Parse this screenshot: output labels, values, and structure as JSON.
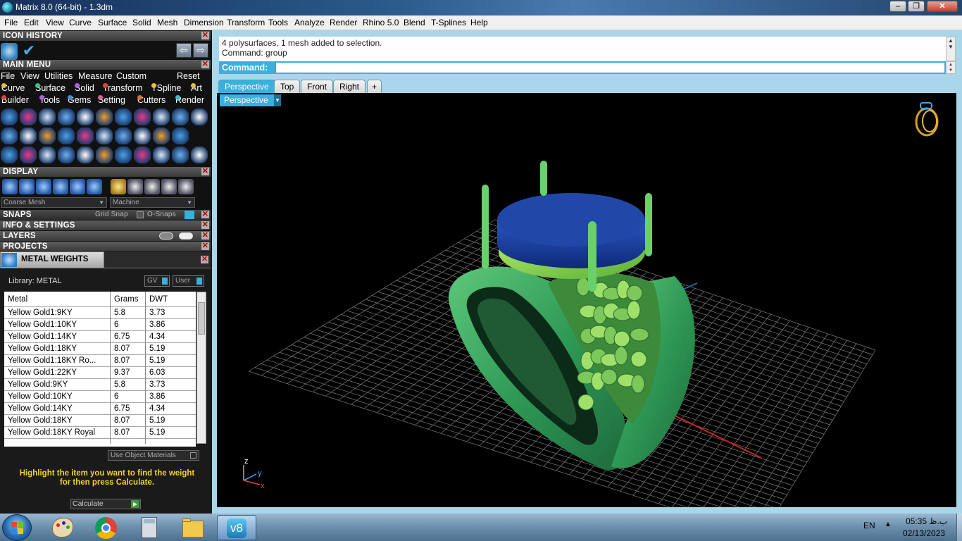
{
  "window": {
    "title": "Matrix 8.0 (64-bit) - 1.3dm",
    "minimize": "‒",
    "maximize": "❐",
    "close": "✕"
  },
  "menubar": {
    "items": [
      "File",
      "Edit",
      "View",
      "Curve",
      "Surface",
      "Solid",
      "Mesh",
      "Dimension",
      "Transform",
      "Tools",
      "Analyze",
      "Render",
      "Rhino 5.0",
      "Blend",
      "T-Splines",
      "Help"
    ]
  },
  "panel": {
    "icon_history": "ICON HISTORY",
    "main_menu": "MAIN MENU",
    "main_menu_items": [
      "File",
      "View",
      "Utilities",
      "Measure",
      "Custom"
    ],
    "reset": "Reset",
    "row1": [
      {
        "label": "Curve",
        "color": "#e0c040"
      },
      {
        "label": "Surface",
        "color": "#40c080"
      },
      {
        "label": "Solid",
        "color": "#b060e0"
      },
      {
        "label": "Transform",
        "color": "#e04040"
      },
      {
        "label": "TSpline",
        "color": "#e0c040"
      },
      {
        "label": "Art",
        "color": "#e0c040"
      }
    ],
    "row2": [
      {
        "label": "Builder",
        "color": "#e04040"
      },
      {
        "label": "Tools",
        "color": "#b060e0"
      },
      {
        "label": "Gems",
        "color": "#4090e0"
      },
      {
        "label": "Setting",
        "color": "#e060a0"
      },
      {
        "label": "Cutters",
        "color": "#e07030"
      },
      {
        "label": "Render",
        "color": "#40c0c0"
      }
    ],
    "display": "DISPLAY",
    "display_mesh": "Coarse Mesh",
    "display_material": "Machine",
    "snaps": "SNAPS",
    "grid_snap": "Grid Snap",
    "osnaps": "O-Snaps",
    "info_settings": "INFO & SETTINGS",
    "layers": "LAYERS",
    "projects": "PROJECTS",
    "close_glyph": "✕",
    "prev_arrow": "⇦",
    "next_arrow": "⇨"
  },
  "metal_weights": {
    "title": "METAL WEIGHTS",
    "library_label": "Library: METAL",
    "gv": "GV",
    "user": "User",
    "columns": [
      "Metal",
      "Grams",
      "DWT"
    ],
    "rows": [
      [
        "Yellow Gold1:9KY",
        "5.8",
        "3.73"
      ],
      [
        "Yellow Gold1:10KY",
        "6",
        "3.86"
      ],
      [
        "Yellow Gold1:14KY",
        "6.75",
        "4.34"
      ],
      [
        "Yellow Gold1:18KY",
        "8.07",
        "5.19"
      ],
      [
        "Yellow Gold1:18KY Ro...",
        "8.07",
        "5.19"
      ],
      [
        "Yellow Gold1:22KY",
        "9.37",
        "6.03"
      ],
      [
        "Yellow Gold:9KY",
        "5.8",
        "3.73"
      ],
      [
        "Yellow Gold:10KY",
        "6",
        "3.86"
      ],
      [
        "Yellow Gold:14KY",
        "6.75",
        "4.34"
      ],
      [
        "Yellow Gold:18KY",
        "8.07",
        "5.19"
      ],
      [
        "Yellow Gold:18KY Royal",
        "8.07",
        "5.19"
      ]
    ],
    "use_object_materials": "Use Object Materials",
    "hint_line1": "Highlight the item you want to find the weight",
    "hint_line2": "for then press Calculate.",
    "calculate": "Calculate"
  },
  "command": {
    "history_line1": "4 polysurfaces, 1 mesh added to selection.",
    "history_line2": "Command: group",
    "prompt": "Command:"
  },
  "viewport_tabs": [
    "Perspective",
    "Top",
    "Front",
    "Right"
  ],
  "add_tab": "+",
  "viewport": {
    "label": "Perspective",
    "axis_z": "z",
    "axis_y": "y",
    "axis_x": "x"
  },
  "taskbar": {
    "apps": [
      "start",
      "paint",
      "chrome",
      "calculator",
      "explorer",
      "matrix-v8"
    ],
    "matrix_label": "v8",
    "lang": "EN",
    "time": "05:35 ب.ظ",
    "date": "02/13/2023"
  },
  "colors": {
    "accent": "#3ab0dc",
    "ring_green": "#3aa85c",
    "gem_blue": "#1c3e9c",
    "hint_yellow": "#f5d020"
  }
}
